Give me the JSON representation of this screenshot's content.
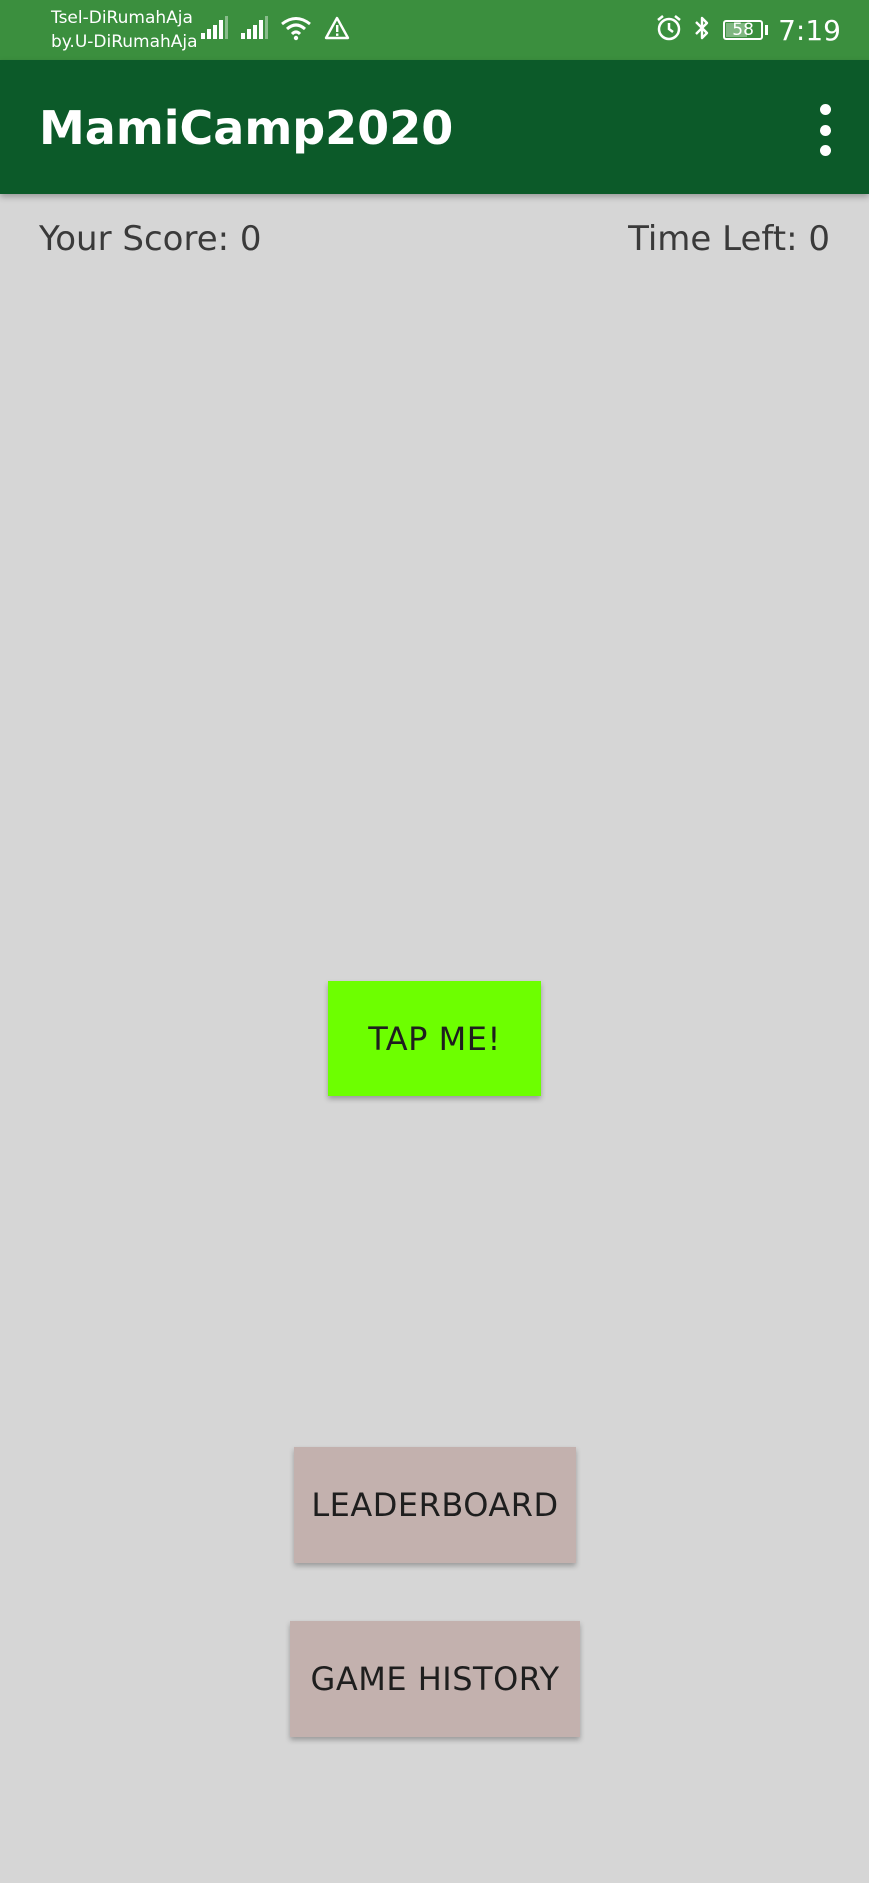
{
  "status_bar": {
    "carrier_line1": "Tsel-DiRumahAja",
    "carrier_line2": "by.U-DiRumahAja",
    "battery_level": "58",
    "battery_fraction": 0.58,
    "time": "7:19",
    "icons": [
      "signal-icon",
      "signal-icon",
      "wifi-icon",
      "warning-icon",
      "alarm-icon",
      "bluetooth-icon",
      "battery-icon"
    ],
    "background_color": "#3b8f3e"
  },
  "app_bar": {
    "title": "MamiCamp2020",
    "menu_icon": "more-vert-icon",
    "background_color": "#0c5a29"
  },
  "game": {
    "score_label": "Your Score: 0",
    "time_label": "Time Left: 0",
    "tap_button_label": "TAP ME!",
    "tap_button_color": "#6dff00"
  },
  "actions": {
    "leaderboard_label": "LEADERBOARD",
    "game_history_label": "GAME HISTORY",
    "button_color": "#c3b1ae"
  }
}
